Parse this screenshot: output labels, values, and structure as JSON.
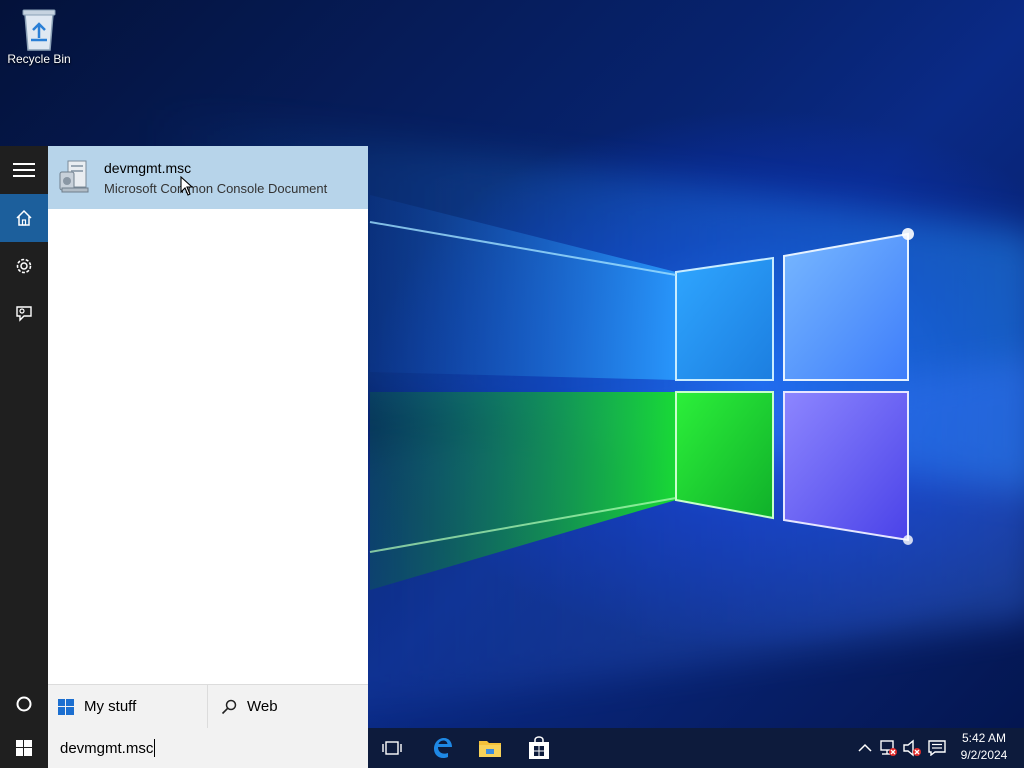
{
  "desktop": {
    "icons": [
      {
        "label": "Recycle Bin",
        "icon": "recycle-bin-icon"
      }
    ]
  },
  "start_panel": {
    "rail": [
      {
        "name": "menu",
        "icon": "hamburger-icon"
      },
      {
        "name": "home",
        "icon": "home-icon",
        "active": true
      },
      {
        "name": "settings",
        "icon": "gear-icon"
      },
      {
        "name": "feedback",
        "icon": "feedback-icon"
      },
      {
        "name": "cortana",
        "icon": "cortana-circle-icon"
      }
    ],
    "best_match": {
      "title": "devmgmt.msc",
      "subtitle": "Microsoft Common Console Document",
      "icon": "msc-document-icon"
    },
    "scopes": {
      "my_stuff": "My stuff",
      "web": "Web"
    }
  },
  "taskbar": {
    "search_value": "devmgmt.msc",
    "apps": [
      {
        "name": "task-view",
        "icon": "task-view-icon"
      },
      {
        "name": "edge",
        "icon": "edge-icon"
      },
      {
        "name": "file-explorer",
        "icon": "folder-icon"
      },
      {
        "name": "store",
        "icon": "store-icon"
      }
    ],
    "tray": [
      {
        "name": "show-hidden",
        "icon": "chevron-up-icon"
      },
      {
        "name": "network",
        "icon": "network-disconnected-icon"
      },
      {
        "name": "volume",
        "icon": "volume-muted-icon"
      },
      {
        "name": "action-center",
        "icon": "notification-icon"
      }
    ],
    "clock": {
      "time": "5:42 AM",
      "date": "9/2/2024"
    }
  },
  "colors": {
    "accent": "#1c5f9c",
    "selected_result": "#b7d4ea",
    "rail_bg": "#1f1f1f",
    "taskbar_bg": "#0d1b3c"
  }
}
